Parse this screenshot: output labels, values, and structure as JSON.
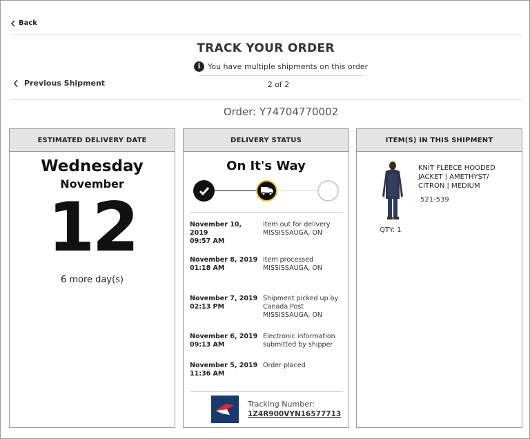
{
  "nav": {
    "back_label": "Back",
    "previous_label": "Previous Shipment"
  },
  "header": {
    "title": "TRACK YOUR ORDER",
    "multi_notice": "You have multiple shipments on this order",
    "shipment_count": "2 of 2",
    "order": "Order: Y74704770002"
  },
  "delivery_date": {
    "heading": "ESTIMATED DELIVERY DATE",
    "weekday": "Wednesday",
    "month": "November",
    "day": "12",
    "remaining": "6 more day(s)"
  },
  "status": {
    "heading": "DELIVERY STATUS",
    "title": "On It's Way",
    "steps": [
      {
        "state": "done",
        "icon": "check-icon"
      },
      {
        "state": "current",
        "icon": "truck-icon"
      },
      {
        "state": "todo",
        "icon": "empty-circle"
      }
    ],
    "events": [
      {
        "date": "November 10, 2019",
        "time": "09:57 AM",
        "desc": [
          "Item out for delivery",
          "MISSISSAUGA, ON"
        ]
      },
      {
        "date": "November 8, 2019",
        "time": "01:18 AM",
        "desc": [
          "Item processed",
          "MISSISSAUGA, ON"
        ]
      },
      {
        "date": "November 7, 2019",
        "time": "02:13 PM",
        "desc": [
          "Shipment picked up by",
          "Canada Post",
          "MISSISSAUGA, ON"
        ]
      },
      {
        "date": "November 6, 2019",
        "time": "09:13 AM",
        "desc": [
          "Electronic information",
          "submitted by shipper"
        ]
      },
      {
        "date": "November 5, 2019",
        "time": "11:36 AM",
        "desc": [
          "Order placed"
        ]
      }
    ],
    "tracking_label": "Tracking Number:",
    "tracking_number": "1Z4R900VYN16577713"
  },
  "items": {
    "heading": "ITEM(S) IN THIS SHIPMENT",
    "list": [
      {
        "name_lines": [
          "KNIT FLEECE HOODED",
          "JACKET | AMETHYST/",
          "CITRON | MEDIUM"
        ],
        "sku": "521-539",
        "qty": "QTY: 1"
      }
    ]
  },
  "colors": {
    "panel_header": "#e4e4e4",
    "accent_yellow": "#f0c33c",
    "canada_post_blue": "#1a3a6e",
    "canada_post_red": "#e0272c"
  }
}
